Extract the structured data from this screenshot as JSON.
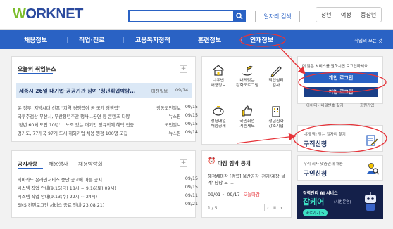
{
  "header": {
    "logo_prefix": "W",
    "logo_rest": "ORKNET",
    "job_search_label": "일자리 검색",
    "user_types": [
      "청년",
      "여성",
      "중장년"
    ]
  },
  "nav": {
    "items": [
      "채용정보",
      "직업·진로",
      "고용복지정책",
      "훈련정보",
      "인재정보"
    ],
    "all_label": "취업의 모든 것"
  },
  "news": {
    "title": "오늘의 취업뉴스",
    "plus": "+",
    "headline": "세종시 26일 대기업·공공기관 참여 '청년취업박람...",
    "headline_source": "마천일보",
    "headline_date": "09/14",
    "items": [
      {
        "text": "윤 정부, 지방시대 선포 \"지역 경쟁력이 곧 국가 경쟁력\"",
        "source": "광동도민일보",
        "date": "09/15"
      },
      {
        "text": "국투주검상 부산시, 부산청년주간 행사…공연 등 콘텐츠 다양",
        "source": "뉴스핌",
        "date": "09/15"
      },
      {
        "text": "'정년 60세 도입 10년' ...노조 있는 대기업 정규직에 혜택 집중",
        "source": "국민일보",
        "date": "09/15"
      },
      {
        "text": "경기도, 77개국 97개 도시 해외기업 채용 행정 100명 모집",
        "source": "뉴스핌",
        "date": "09/14"
      }
    ]
  },
  "services": [
    {
      "label": "나우번\n채용정보",
      "icon": "house-icon"
    },
    {
      "label": "내게맞는\n강화도로그램",
      "icon": "leaf-hands-icon"
    },
    {
      "label": "직업심리\n검사",
      "icon": "pencil-icon"
    },
    {
      "label": "청년내일\n채움공제",
      "icon": "piggy-bank-icon"
    },
    {
      "label": "국민취업\n지원제도",
      "icon": "thumbs-up-icon"
    },
    {
      "label": "청년친화\n강소기업",
      "icon": "building-icon"
    }
  ],
  "login": {
    "notice": "더 많은 서비스를 원하시면 로그인하세요.",
    "personal_label": "개인 로그인",
    "corporate_label": "기업 로그인",
    "find_label": "아이디 · 비밀번호 찾기",
    "signup_label": "회원가입"
  },
  "job_request": {
    "small": "내게 딱! 맞는 일자리 찾기",
    "big": "구직신청"
  },
  "recruit_request": {
    "small": "우리 회사 맞춤인재 채용",
    "big": "구인신청"
  },
  "notice": {
    "tabs": [
      "공지사항",
      "채용행사",
      "채용박람회"
    ],
    "plus": "+",
    "items": [
      {
        "text": "비바카드 온라인서비스 중단 공고에 따른 공지",
        "date": "09/15"
      },
      {
        "text": "시스템 작업 안내(9.15(금) 18시 ~ 9.16(토) 09시)",
        "date": "09/15"
      },
      {
        "text": "시스템 작업 안내(9.13(수) 22시 ~ 24시)",
        "date": "09/11"
      },
      {
        "text": "SNS 간편로그인 서비스 종료 안내(23.08.21)",
        "date": "08/21"
      }
    ]
  },
  "event": {
    "title": "마감 임박 공채",
    "content": "해정체마감 [경력] 울산공장 '전기/계장 설계' 담당 모 ...",
    "period": "09/01 ~ 09/17",
    "deadline": "오늘마감",
    "page": "1 / 5",
    "prev": "‹",
    "pause": "II",
    "next": "›"
  },
  "ai_banner": {
    "line1": "경력관리 AI 서비스",
    "line2": "잡케어",
    "line2_small": "(시범운영)",
    "button": "바로가기 >"
  },
  "colors": {
    "primary": "#2a62c4",
    "accent_red": "#e63339",
    "logo_green": "#7cbd2c"
  }
}
